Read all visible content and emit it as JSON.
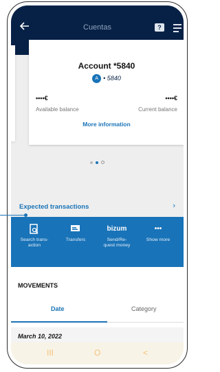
{
  "header": {
    "title": "Cuentas",
    "back_icon": "arrow-left-icon",
    "chat_icon": "chat-icon",
    "chat_glyph": "?",
    "menu_icon": "menu-icon"
  },
  "account": {
    "title": "Account *5840",
    "number": "• 5840",
    "logo_glyph": "A",
    "available_value": "••••€",
    "available_label": "Available balance",
    "current_value": "••••€",
    "current_label": "Current balance",
    "more_info": "More information"
  },
  "pager": {
    "total": 3,
    "active": 2
  },
  "expected": {
    "label": "Expected transactions",
    "chevron": "›"
  },
  "actions": [
    {
      "icon": "search-icon",
      "glyph": "⌕",
      "label": "Search trans-\naction"
    },
    {
      "icon": "transfer-icon",
      "glyph": "▭",
      "label": "Transfers"
    },
    {
      "icon": "bizum-icon",
      "glyph": "bizum",
      "label": "Send/Re-\nquest money"
    },
    {
      "icon": "more-icon",
      "glyph": "•••",
      "label": "Show more"
    }
  ],
  "movements": {
    "title": "MOVEMENTS",
    "tabs": [
      "Date",
      "Category"
    ],
    "active_tab": "Date",
    "first_date": "March 10, 2022"
  },
  "navbar": {
    "recent": "III",
    "home": "O",
    "back": "<"
  },
  "colors": {
    "header": "#072146",
    "accent": "#1973b8",
    "nav": "#f5c27a"
  }
}
